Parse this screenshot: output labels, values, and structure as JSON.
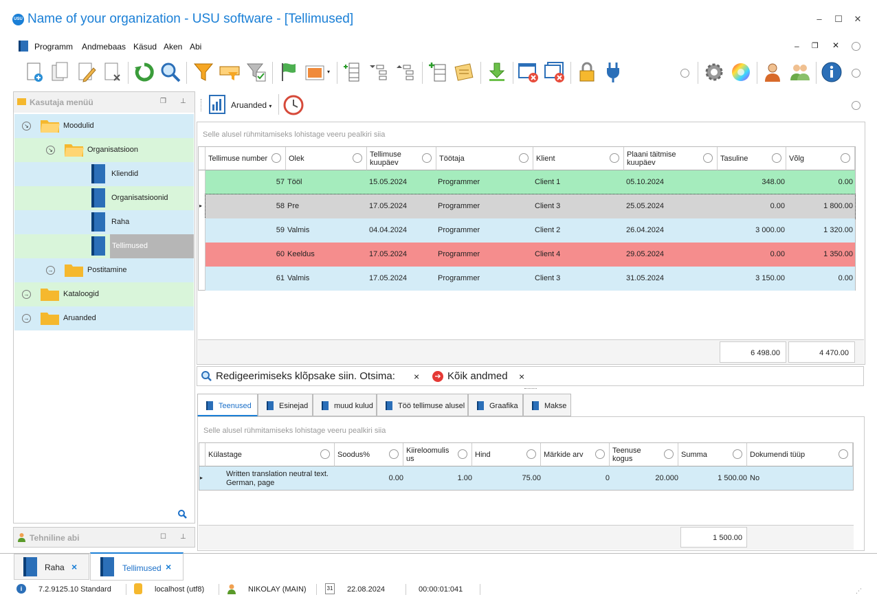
{
  "window": {
    "title": "Name of your organization - USU software - [Tellimused]",
    "logo_text": "USU"
  },
  "menu": [
    "Programm",
    "Andmebaas",
    "Käsud",
    "Aken",
    "Abi"
  ],
  "left_panel": {
    "title": "Kasutaja menüü",
    "tree": [
      {
        "label": "Moodulid"
      },
      {
        "label": "Organisatsioon"
      },
      {
        "label": "Kliendid"
      },
      {
        "label": "Organisatsioonid"
      },
      {
        "label": "Raha"
      },
      {
        "label": "Tellimused"
      },
      {
        "label": "Postitamine"
      },
      {
        "label": "Kataloogid"
      },
      {
        "label": "Aruanded"
      }
    ],
    "bottom_title": "Tehniline abi"
  },
  "report_toolbar": {
    "label": "Aruanded"
  },
  "main_grid": {
    "group_hint": "Selle alusel rühmitamiseks lohistage veeru pealkiri siia",
    "columns": [
      "Tellimuse number",
      "Olek",
      "Tellimuse kuupäev",
      "Töötaja",
      "Klient",
      "Plaani täitmise kuupäev",
      "Tasuline",
      "Võlg"
    ],
    "rows": [
      {
        "num": "57",
        "status": "Tööl",
        "date": "15.05.2024",
        "worker": "Programmer",
        "client": "Client 1",
        "plan": "05.10.2024",
        "paid": "348.00",
        "debt": "0.00",
        "color": "#a5ecbd"
      },
      {
        "num": "58",
        "status": "Pre",
        "date": "17.05.2024",
        "worker": "Programmer",
        "client": "Client 3",
        "plan": "25.05.2024",
        "paid": "0.00",
        "debt": "1 800.00",
        "color": "#d4d4d4"
      },
      {
        "num": "59",
        "status": "Valmis",
        "date": "04.04.2024",
        "worker": "Programmer",
        "client": "Client 2",
        "plan": "26.04.2024",
        "paid": "3 000.00",
        "debt": "1 320.00",
        "color": "#d4ecf7"
      },
      {
        "num": "60",
        "status": "Keeldus",
        "date": "17.05.2024",
        "worker": "Programmer",
        "client": "Client 4",
        "plan": "29.05.2024",
        "paid": "0.00",
        "debt": "1 350.00",
        "color": "#f58d8d"
      },
      {
        "num": "61",
        "status": "Valmis",
        "date": "17.05.2024",
        "worker": "Programmer",
        "client": "Client 3",
        "plan": "31.05.2024",
        "paid": "3 150.00",
        "debt": "0.00",
        "color": "#d4ecf7"
      }
    ],
    "totals": {
      "paid": "6 498.00",
      "debt": "4 470.00"
    }
  },
  "search_bar": {
    "label": "Redigeerimiseks klõpsake siin. Otsima:",
    "all_data": "Kõik andmed",
    "close": "×"
  },
  "detail_tabs": [
    "Teenused",
    "Esinejad",
    "muud kulud",
    "Töö tellimuse alusel",
    "Graafika",
    "Makse"
  ],
  "detail_grid": {
    "group_hint": "Selle alusel rühmitamiseks lohistage veeru pealkiri siia",
    "columns": [
      "Külastage",
      "Soodus%",
      "Kiireloomulisus",
      "Hind",
      "Märkide arv",
      "Teenuse kogus",
      "Summa",
      "Dokumendi tüüp"
    ],
    "row": {
      "name": "Written translation neutral text. German, page",
      "discount": "0.00",
      "urgency": "1.00",
      "price": "75.00",
      "chars": "0",
      "qty": "20.000",
      "sum": "1 500.00",
      "doc": "No"
    },
    "total": "1 500.00"
  },
  "window_tabs": [
    {
      "label": "Raha",
      "close": "×"
    },
    {
      "label": "Tellimused",
      "close": "×"
    }
  ],
  "status": {
    "version": "7.2.9125.10 Standard",
    "db": "localhost (utf8)",
    "user": "NIKOLAY (MAIN)",
    "date": "22.08.2024",
    "timer": "00:00:01:041",
    "calendar_day": "31"
  },
  "colors": {
    "accent": "#1a7fd6",
    "green_row": "#d9f5da",
    "blue_row": "#d4ecf7",
    "selected": "#b6b6b6"
  }
}
